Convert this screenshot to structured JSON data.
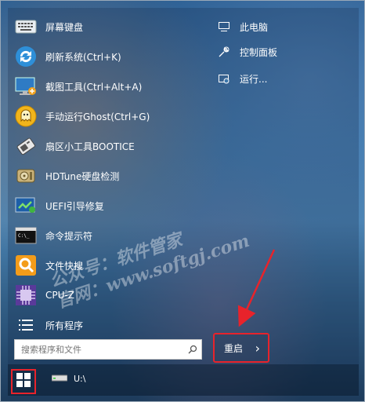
{
  "apps": [
    {
      "label": "屏幕键盘",
      "icon": "keyboard-icon"
    },
    {
      "label": "刷新系统(Ctrl+K)",
      "icon": "refresh-icon"
    },
    {
      "label": "截图工具(Ctrl+Alt+A)",
      "icon": "screenshot-icon"
    },
    {
      "label": "手动运行Ghost(Ctrl+G)",
      "icon": "ghost-icon"
    },
    {
      "label": "扇区小工具BOOTICE",
      "icon": "bootice-icon"
    },
    {
      "label": "HDTune硬盘检测",
      "icon": "hdtune-icon"
    },
    {
      "label": "UEFI引导修复",
      "icon": "uefi-repair-icon"
    },
    {
      "label": "命令提示符",
      "icon": "cmd-icon"
    },
    {
      "label": "文件快搜",
      "icon": "file-search-icon"
    },
    {
      "label": "CPU-Z",
      "icon": "cpuz-icon"
    },
    {
      "label": "所有程序",
      "icon": "all-programs-icon"
    }
  ],
  "right_items": [
    {
      "label": "此电脑",
      "icon": "computer-icon"
    },
    {
      "label": "控制面板",
      "icon": "wrench-icon"
    },
    {
      "label": "运行...",
      "icon": "run-icon"
    }
  ],
  "search": {
    "placeholder": "搜索程序和文件"
  },
  "restart": {
    "label": "重启",
    "arrow": "›"
  },
  "taskbar": {
    "drive_label": "U:\\"
  },
  "watermark": {
    "line1": "公众号：软件管家",
    "line2": "官网：www.softgj.com"
  },
  "colors": {
    "highlight": "#e8232b",
    "accent": "#3d77ab"
  }
}
